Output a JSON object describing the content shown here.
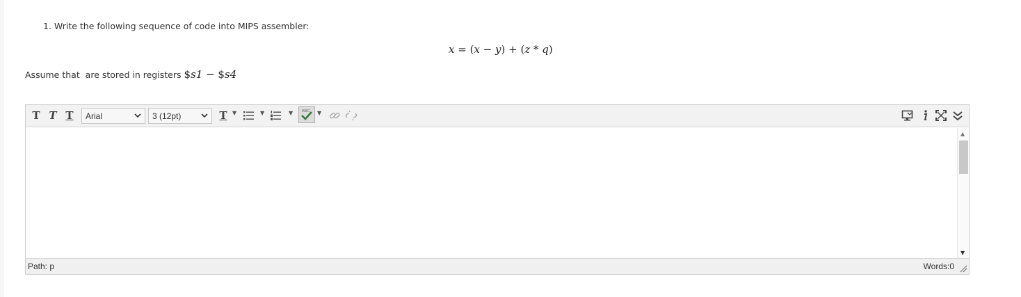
{
  "question": {
    "number": "1.",
    "text": "Write the following sequence of code into MIPS assembler:"
  },
  "formula": {
    "lhs": "x",
    "eq": " = ",
    "p1": "(",
    "x": "x",
    "minus": " − ",
    "y": "y",
    "p2": ")",
    "plus": " + ",
    "p3": "(",
    "z": "z",
    "star": " * ",
    "q": "q",
    "p4": ")"
  },
  "assume": {
    "text": "Assume that  are stored in registers ",
    "reg1_dollar": "$",
    "reg1": "s1",
    "dash": " − ",
    "reg2_dollar": "$",
    "reg2": "s4"
  },
  "toolbar": {
    "bold_label": "T",
    "italic_label": "T",
    "underline_label": "T",
    "font_family": "Arial",
    "font_size": "3 (12pt)",
    "text_format_label": "T",
    "spell_badge": "ABC",
    "icons": [
      "bold-icon",
      "italic-icon",
      "underline-icon",
      "font-color-icon",
      "unordered-list-icon",
      "ordered-list-icon",
      "spellcheck-icon",
      "link-icon",
      "unlink-icon",
      "preview-icon",
      "info-icon",
      "fullscreen-icon",
      "expand-icon"
    ]
  },
  "editor": {
    "path_label": "Path: p",
    "words_label": "Words:0"
  },
  "colors": {
    "toolbar_bg": "#f2f2f2",
    "border": "#cfcfcf",
    "text": "#333333"
  }
}
